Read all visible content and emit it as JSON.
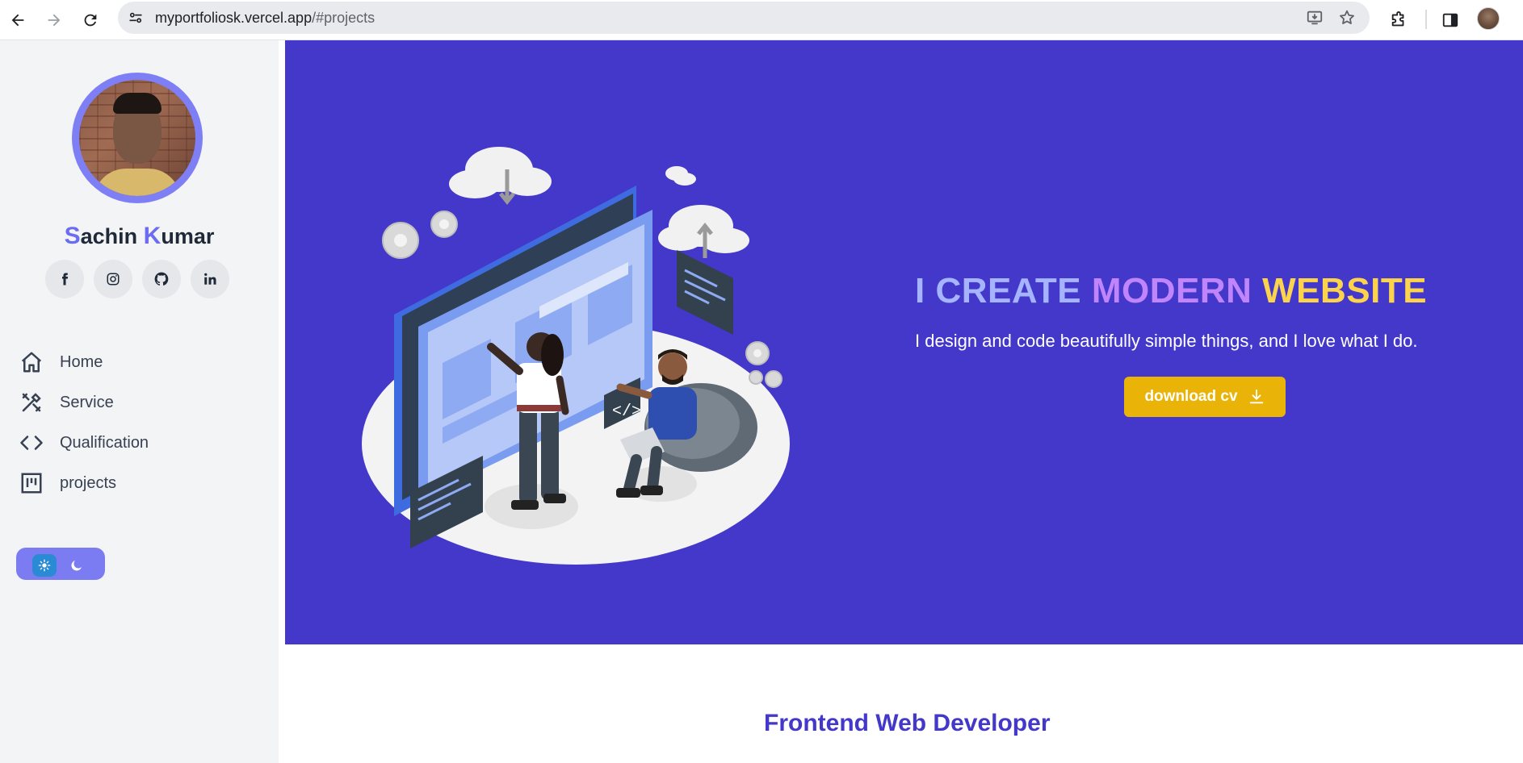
{
  "browser": {
    "url_host": "myportfoliosk.vercel.app",
    "url_path": "/#projects",
    "icons": [
      "back-icon",
      "forward-icon",
      "reload-icon",
      "site-settings-icon",
      "install-app-icon",
      "bookmark-star-icon",
      "extensions-icon",
      "side-panel-icon",
      "profile-avatar"
    ]
  },
  "sidebar": {
    "name_first_initial": "S",
    "name_first_rest": "achin ",
    "name_last_initial": "K",
    "name_last_rest": "umar",
    "socials": [
      {
        "icon": "facebook-icon",
        "glyph": "f"
      },
      {
        "icon": "instagram-icon",
        "glyph": ""
      },
      {
        "icon": "github-icon",
        "glyph": ""
      },
      {
        "icon": "linkedin-icon",
        "glyph": "in"
      }
    ],
    "menu": [
      {
        "label": "Home",
        "icon": "home-icon"
      },
      {
        "label": "Service",
        "icon": "tools-icon"
      },
      {
        "label": "Qualification",
        "icon": "code-icon"
      },
      {
        "label": "projects",
        "icon": "kanban-icon"
      }
    ],
    "theme_toggle": {
      "light_icon": "sun-icon",
      "dark_icon": "moon-icon",
      "active": "light"
    }
  },
  "hero": {
    "title_words": [
      {
        "text": "I",
        "color": "#a5b4fc"
      },
      {
        "text": "CREATE",
        "color": "#a5b4fc"
      },
      {
        "text": "MODERN",
        "color": "#c084fc"
      },
      {
        "text": "WEBSITE",
        "color": "#fcd34d"
      }
    ],
    "subtitle": "I design and code beautifully simple things, and I love what I do.",
    "cta_label": "download cv",
    "cta_icon": "download-icon",
    "background": "#4338ca",
    "cta_color": "#eab308"
  },
  "section": {
    "title": "Frontend Web Developer"
  }
}
